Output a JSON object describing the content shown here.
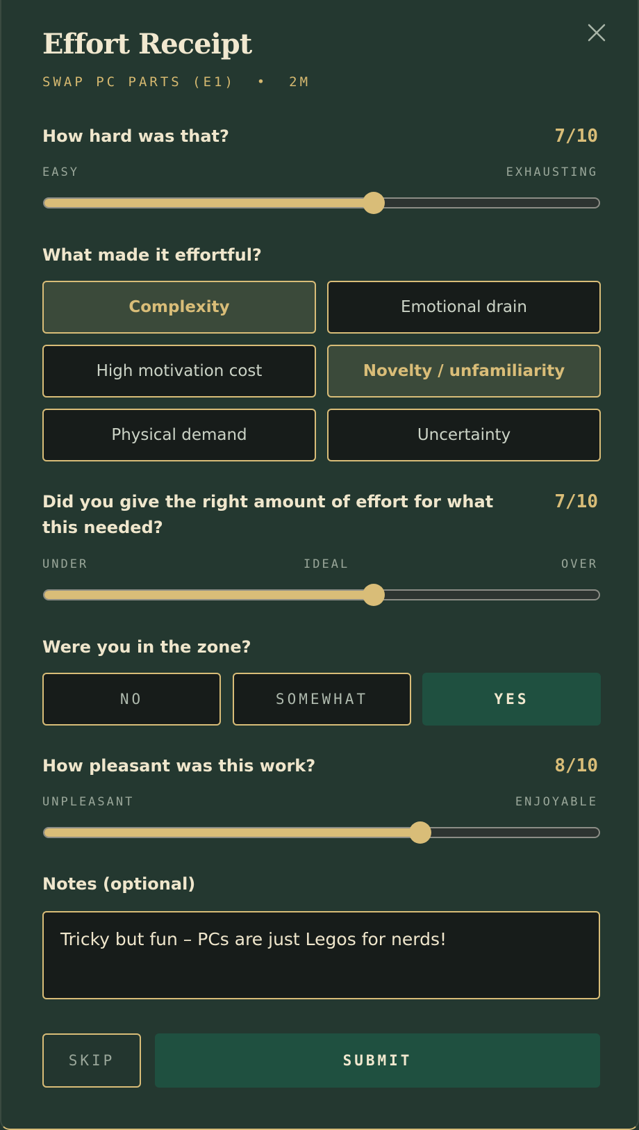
{
  "header": {
    "title": "Effort Receipt",
    "task": "SWAP PC PARTS (E1)",
    "separator": "•",
    "duration": "2M",
    "close_icon": "close-icon"
  },
  "difficulty": {
    "question": "How hard was that?",
    "value_text": "7/10",
    "value": 7,
    "max": 10,
    "min_label": "EASY",
    "max_label": "EXHAUSTING"
  },
  "factors": {
    "question": "What made it effortful?",
    "options": [
      {
        "label": "Complexity",
        "selected": true
      },
      {
        "label": "Emotional drain",
        "selected": false
      },
      {
        "label": "High motivation cost",
        "selected": false
      },
      {
        "label": "Novelty / unfamiliarity",
        "selected": true
      },
      {
        "label": "Physical demand",
        "selected": false
      },
      {
        "label": "Uncertainty",
        "selected": false
      }
    ]
  },
  "effort_fit": {
    "question": "Did you give the right amount of effort for what this needed?",
    "value_text": "7/10",
    "value": 7,
    "max": 10,
    "min_label": "UNDER",
    "mid_label": "IDEAL",
    "max_label": "OVER"
  },
  "zone": {
    "question": "Were you in the zone?",
    "options": [
      {
        "label": "NO",
        "selected": false
      },
      {
        "label": "SOMEWHAT",
        "selected": false
      },
      {
        "label": "YES",
        "selected": true
      }
    ]
  },
  "pleasantness": {
    "question": "How pleasant was this work?",
    "value_text": "8/10",
    "value": 8,
    "max": 10,
    "min_label": "UNPLEASANT",
    "max_label": "ENJOYABLE"
  },
  "notes": {
    "label": "Notes (optional)",
    "value": "Tricky but fun – PCs are just Legos for nerds!"
  },
  "actions": {
    "skip_label": "SKIP",
    "submit_label": "SUBMIT"
  },
  "colors": {
    "background": "#243830",
    "accent": "#d9bd78",
    "selected_green": "#1f5040"
  }
}
